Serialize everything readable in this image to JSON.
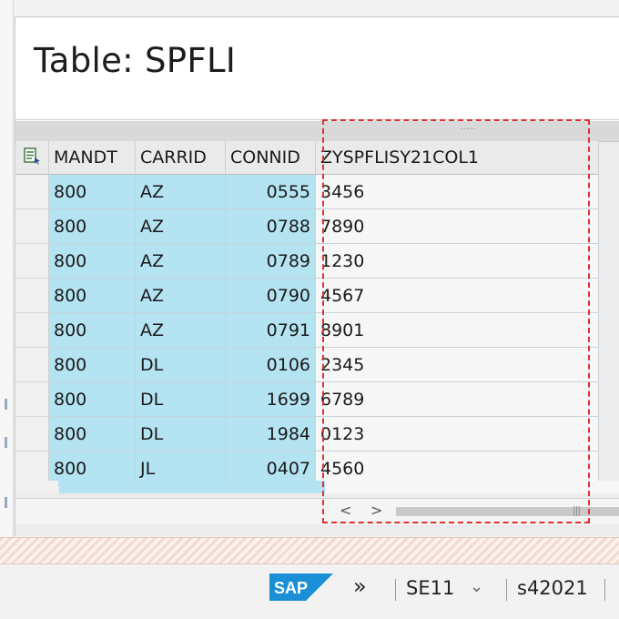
{
  "window": {
    "title": "Table: SPFLI"
  },
  "grid": {
    "columns": [
      "MANDT",
      "CARRID",
      "CONNID",
      "ZYSPFLISY21COL1"
    ],
    "rows": [
      [
        "800",
        "AZ",
        "0555",
        "3456"
      ],
      [
        "800",
        "AZ",
        "0788",
        "7890"
      ],
      [
        "800",
        "AZ",
        "0789",
        "1230"
      ],
      [
        "800",
        "AZ",
        "0790",
        "4567"
      ],
      [
        "800",
        "AZ",
        "0791",
        "8901"
      ],
      [
        "800",
        "DL",
        "0106",
        "2345"
      ],
      [
        "800",
        "DL",
        "1699",
        "6789"
      ],
      [
        "800",
        "DL",
        "1984",
        "0123"
      ],
      [
        "800",
        "JL",
        "0407",
        "4560"
      ]
    ],
    "key_column_color": "#b4e3f1",
    "select_icon": "layout-select-icon"
  },
  "scrollbar": {
    "left_arrow": "<",
    "right_arrow": ">"
  },
  "highlight": {
    "color": "#e03030"
  },
  "statusbar": {
    "logo": "SAP",
    "expand_icon": "»",
    "transaction": "SE11",
    "dropdown_icon": "⌄",
    "system": "s42021"
  }
}
